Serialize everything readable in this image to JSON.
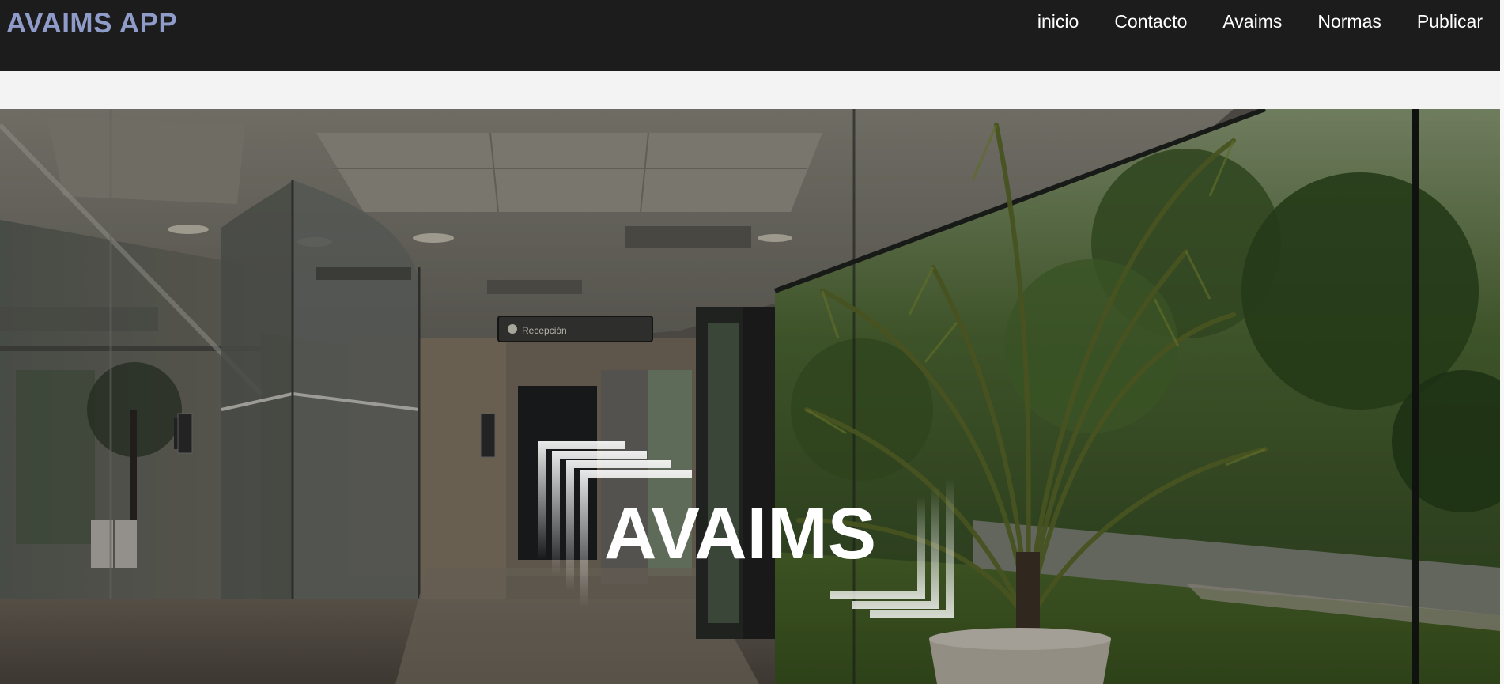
{
  "brand": {
    "title": "AVAIMS APP",
    "color": "#8f9cc9"
  },
  "nav": {
    "items": [
      {
        "label": "inicio"
      },
      {
        "label": "Contacto"
      },
      {
        "label": "Avaims"
      },
      {
        "label": "Normas"
      },
      {
        "label": "Publicar"
      }
    ]
  },
  "hero": {
    "logo_text": "AVAIMS",
    "reception_sign": "Recepción",
    "icons": {
      "logo": "avaims-logo-icon"
    }
  },
  "colors": {
    "navbar_bg": "#1c1c1c",
    "band_bg": "#f3f3f3"
  }
}
